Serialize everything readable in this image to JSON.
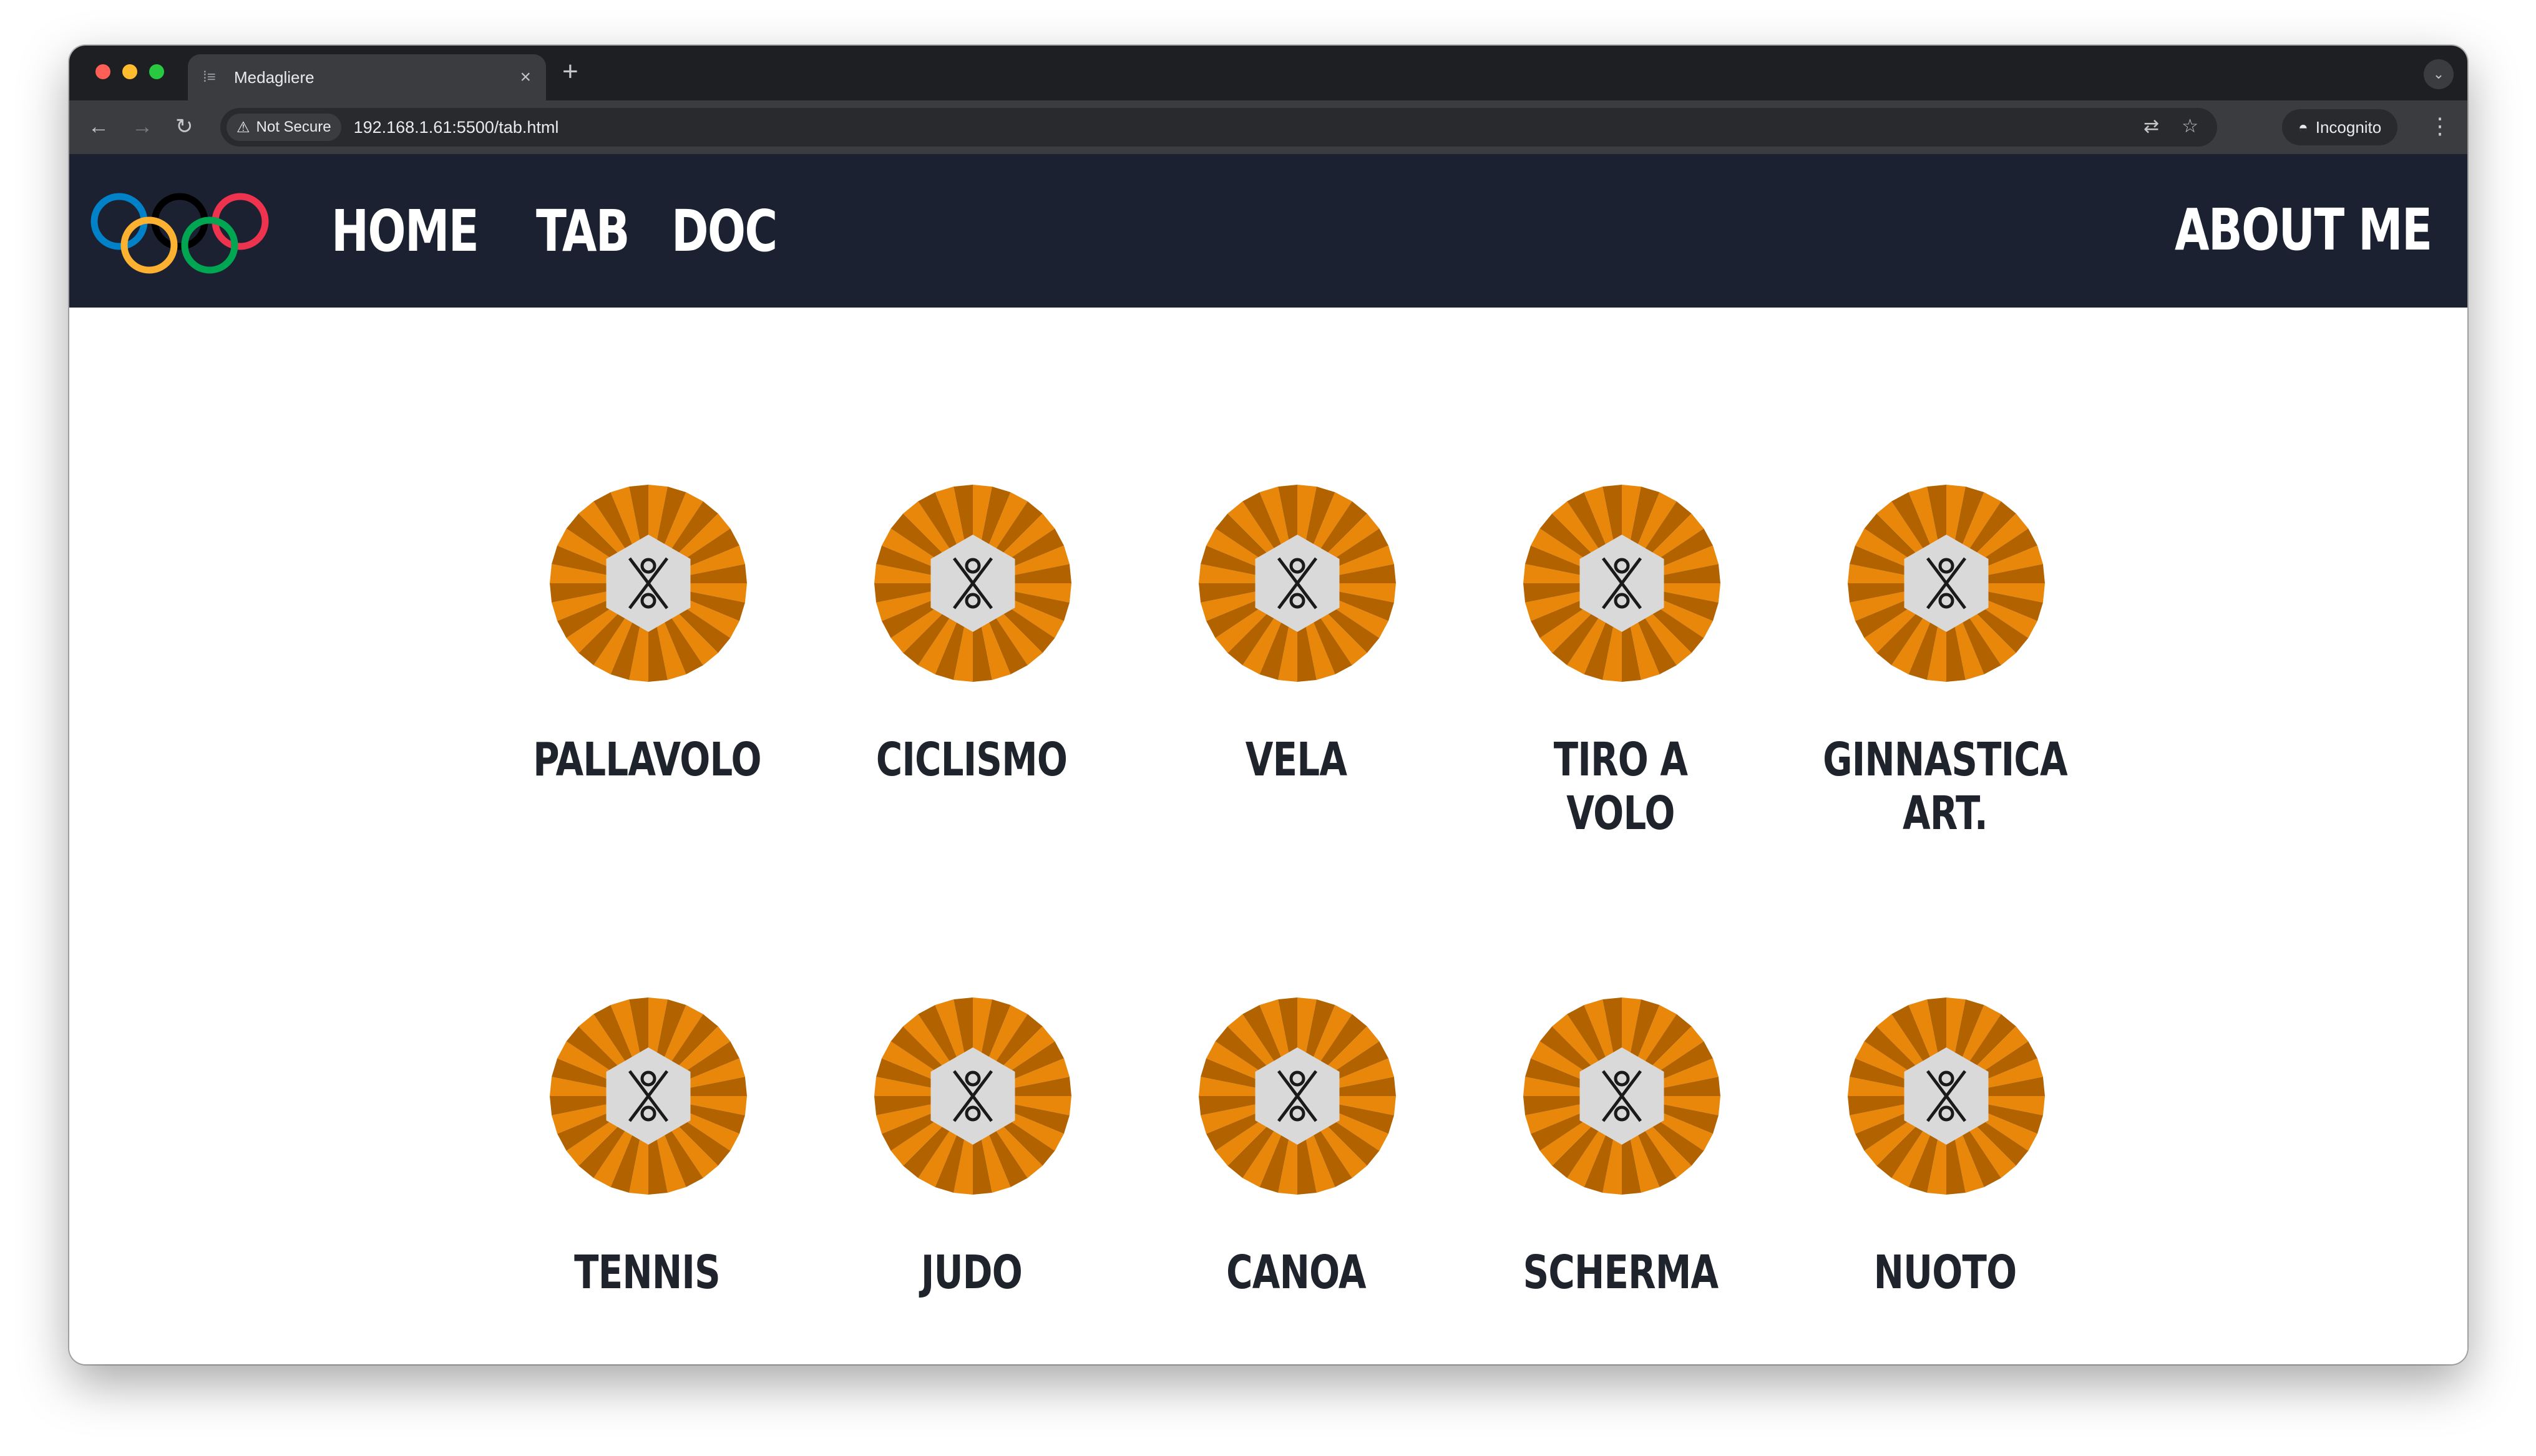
{
  "browser": {
    "tab_title": "Medagliere",
    "tab_close": "×",
    "new_tab": "+",
    "security_label": "Not Secure",
    "url": "192.168.1.61:5500/tab.html",
    "incognito_label": "Incognito"
  },
  "header": {
    "nav": [
      "HOME",
      "TAB",
      "DOC"
    ],
    "about": "ABOUT ME",
    "ring_colors": [
      "#0081c8",
      "#000000",
      "#ee334e",
      "#fcb131",
      "#00a651"
    ]
  },
  "sports": [
    {
      "label": "PALLAVOLO",
      "icon": "volleyball-icon"
    },
    {
      "label": "CICLISMO",
      "icon": "cycling-icon"
    },
    {
      "label": "VELA",
      "icon": "sailing-icon"
    },
    {
      "label": "TIRO A VOLO",
      "icon": "shooting-icon"
    },
    {
      "label": "GINNASTICA ART.",
      "icon": "gymnastics-icon"
    },
    {
      "label": "TENNIS",
      "icon": "tennis-icon"
    },
    {
      "label": "JUDO",
      "icon": "judo-icon"
    },
    {
      "label": "CANOA",
      "icon": "canoe-icon"
    },
    {
      "label": "SCHERMA",
      "icon": "fencing-icon"
    },
    {
      "label": "NUOTO",
      "icon": "swimming-icon"
    }
  ],
  "colors": {
    "medal_light": "#e8870a",
    "medal_dark": "#b36200",
    "hexagon": "#d9d9d9",
    "header_bg": "#1b2130"
  }
}
